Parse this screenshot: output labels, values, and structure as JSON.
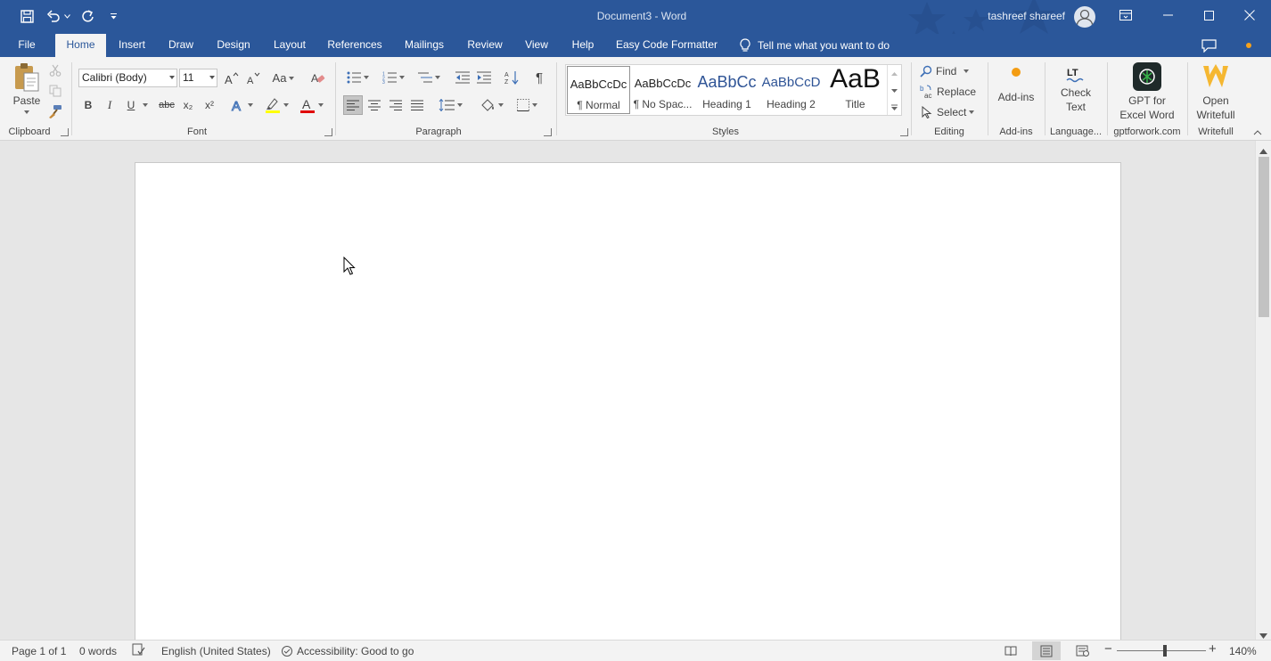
{
  "title_bar": {
    "document_title": "Document3  -  Word",
    "user_name": "tashreef shareef",
    "qat": [
      "save-icon",
      "undo-icon",
      "redo-icon",
      "customize-icon"
    ]
  },
  "tabs": {
    "file": "File",
    "home": "Home",
    "insert": "Insert",
    "draw": "Draw",
    "design": "Design",
    "layout": "Layout",
    "references": "References",
    "mailings": "Mailings",
    "review": "Review",
    "view": "View",
    "help": "Help",
    "easy_code": "Easy Code Formatter",
    "tell_me": "Tell me what you want to do"
  },
  "clipboard": {
    "paste_label": "Paste",
    "group_label": "Clipboard"
  },
  "font": {
    "font_name": "Calibri (Body)",
    "font_size": "11",
    "change_case": "Aa",
    "bold": "B",
    "italic": "I",
    "underline": "U",
    "strikethrough": "abc",
    "subscript": "x₂",
    "superscript": "x²",
    "group_label": "Font",
    "highlight_color": "#ffff00",
    "font_color": "#e00000"
  },
  "paragraph": {
    "group_label": "Paragraph",
    "pilcrow": "¶"
  },
  "styles": {
    "group_label": "Styles",
    "items": [
      {
        "sample": "AaBbCcDc",
        "name": "¶ Normal"
      },
      {
        "sample": "AaBbCcDc",
        "name": "¶ No Spac..."
      },
      {
        "sample": "AaBbCc",
        "name": "Heading 1"
      },
      {
        "sample": "AaBbCcD",
        "name": "Heading 2"
      },
      {
        "sample": "AaB",
        "name": "Title"
      }
    ]
  },
  "editing": {
    "find": "Find",
    "replace": "Replace",
    "select": "Select",
    "group_label": "Editing"
  },
  "addins": {
    "addins_label": "Add-ins",
    "addins_group": "Add-ins",
    "check_text_1": "Check",
    "check_text_2": "Text",
    "language_group": "Language...",
    "gpt_1": "GPT for",
    "gpt_2": "Excel Word",
    "gpt_group": "gptforwork.com",
    "writefull_1": "Open",
    "writefull_2": "Writefull",
    "writefull_group": "Writefull"
  },
  "status_bar": {
    "page": "Page 1 of 1",
    "words": "0 words",
    "language": "English (United States)",
    "accessibility": "Accessibility: Good to go",
    "zoom": "140%",
    "zoom_level": 1.4
  },
  "colors": {
    "brand": "#2b579a",
    "ribbon": "#f3f3f3",
    "canvas": "#e6e6e6"
  }
}
